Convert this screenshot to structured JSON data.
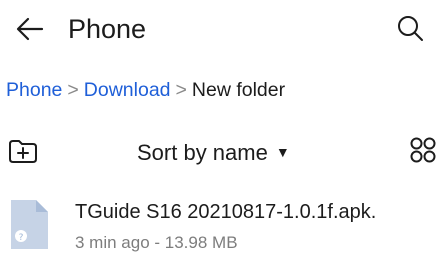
{
  "header": {
    "title": "Phone",
    "back_icon": "arrow-left-icon",
    "search_icon": "search-icon"
  },
  "breadcrumb": {
    "items": [
      "Phone",
      "Download"
    ],
    "current": "New folder",
    "separator": ">"
  },
  "toolbar": {
    "sort_label": "Sort by name",
    "sort_arrow": "▼",
    "new_folder_icon": "folder-add-icon",
    "view_icon": "grid-view-icon"
  },
  "files": [
    {
      "name": "TGuide S16 20210817-1.0.1f.apk.",
      "meta": "3 min ago - 13.98 MB",
      "icon": "apk-file-icon"
    }
  ],
  "colors": {
    "link": "#1f5fd8",
    "meta": "#7d7d7d",
    "file_icon": "#c6d3e6",
    "file_badge": "#9fb6d6"
  }
}
